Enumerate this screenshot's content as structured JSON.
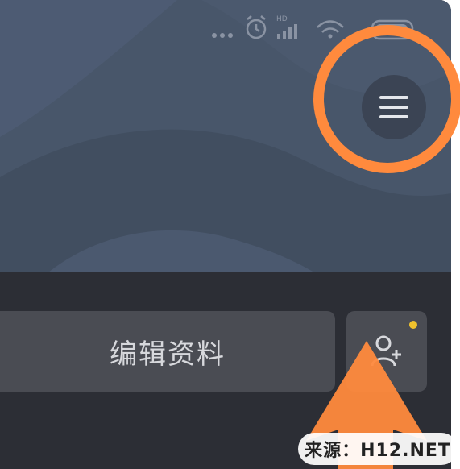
{
  "profile": {
    "edit_label": "编辑资料"
  },
  "header": {
    "menu_icon": "hamburger-menu-icon"
  },
  "status_bar": {
    "icons": [
      "dots-icon",
      "alarm-icon",
      "signal-icon",
      "wifi-icon",
      "battery-icon"
    ],
    "signal_label": "HD"
  },
  "watermark": {
    "text": "来源：H12.NET"
  },
  "colors": {
    "header_bg": "#48566a",
    "page_bg": "#2c2e35",
    "button_bg": "#4a4c53",
    "highlight": "#ff8a3d",
    "notify_dot": "#f0c22d"
  }
}
